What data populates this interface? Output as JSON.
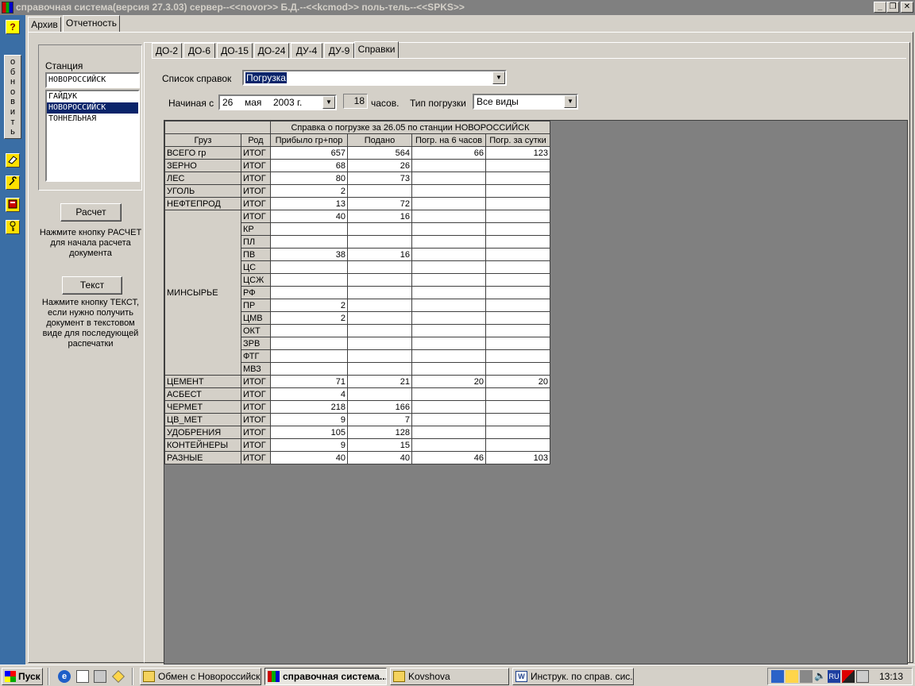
{
  "window": {
    "title": "справочная система(версия 27.3.03) сервер--<<novor>> Б.Д.--<<kcmod>> поль-тель--<<SPKS>>",
    "min_label": "_",
    "max_label": "❐",
    "close_label": "✕"
  },
  "left_toolbar": {
    "help_label": "?",
    "refresh_label": "обновить"
  },
  "top_tabs": [
    {
      "label": "Архив"
    },
    {
      "label": "Отчетность"
    }
  ],
  "station_panel": {
    "label": "Станция",
    "input_value": "НОВОРОССИЙСК",
    "list": [
      "ГАЙДУК",
      "НОВОРОССИЙСК",
      "ТОННЕЛЬНАЯ"
    ],
    "selected_index": 1
  },
  "calc": {
    "button": "Расчет",
    "hint": "Нажмите кнопку РАСЧЕТ для начала расчета документа"
  },
  "text": {
    "button": "Текст",
    "hint": "Нажмите кнопку ТЕКСТ, если нужно получить документ в текстовом виде для последующей распечатки"
  },
  "report_tabs": [
    {
      "label": "ДО-2"
    },
    {
      "label": "ДО-6"
    },
    {
      "label": "ДО-15"
    },
    {
      "label": "ДО-24"
    },
    {
      "label": "ДУ-4"
    },
    {
      "label": "ДУ-9"
    },
    {
      "label": "Справки"
    }
  ],
  "form": {
    "list_label": "Список справок",
    "list_value": "Погрузка",
    "start_label": "Начиная с",
    "day": "26",
    "month": "мая",
    "year": "2003 г.",
    "hours_value": "18",
    "hours_label": "часов.",
    "load_type_label": "Тип погрузки",
    "load_type_value": "Все виды"
  },
  "grid": {
    "caption": "Справка о погрузке за 26.05 по станции НОВОРОССИЙСК",
    "headers": [
      "Груз",
      "Род",
      "Прибыло гр+пор",
      "Подано",
      "Погр. на 6 часов",
      "Погр. за сутки"
    ],
    "rows": [
      {
        "cargo": "ВСЕГО   гр",
        "kind": "ИТОГ",
        "arrived": "657",
        "supplied": "564",
        "load6": "66",
        "load24": "123"
      },
      {
        "cargo": "ЗЕРНО",
        "kind": "ИТОГ",
        "arrived": "68",
        "supplied": "26",
        "load6": "",
        "load24": ""
      },
      {
        "cargo": "ЛЕС",
        "kind": "ИТОГ",
        "arrived": "80",
        "supplied": "73",
        "load6": "",
        "load24": ""
      },
      {
        "cargo": "УГОЛЬ",
        "kind": "ИТОГ",
        "arrived": "2",
        "supplied": "",
        "load6": "",
        "load24": ""
      },
      {
        "cargo": "НЕФТЕПРОД",
        "kind": "ИТОГ",
        "arrived": "13",
        "supplied": "72",
        "load6": "",
        "load24": ""
      }
    ],
    "minsyrye": {
      "cargo": "МИНСЫРЬЕ",
      "rows": [
        {
          "kind": "ИТОГ",
          "arrived": "40",
          "supplied": "16",
          "load6": "",
          "load24": ""
        },
        {
          "kind": "КР",
          "arrived": "",
          "supplied": "",
          "load6": "",
          "load24": ""
        },
        {
          "kind": "ПЛ",
          "arrived": "",
          "supplied": "",
          "load6": "",
          "load24": ""
        },
        {
          "kind": "ПВ",
          "arrived": "38",
          "supplied": "16",
          "load6": "",
          "load24": ""
        },
        {
          "kind": "ЦС",
          "arrived": "",
          "supplied": "",
          "load6": "",
          "load24": ""
        },
        {
          "kind": "ЦСЖ",
          "arrived": "",
          "supplied": "",
          "load6": "",
          "load24": ""
        },
        {
          "kind": "РФ",
          "arrived": "",
          "supplied": "",
          "load6": "",
          "load24": ""
        },
        {
          "kind": "ПР",
          "arrived": "2",
          "supplied": "",
          "load6": "",
          "load24": ""
        },
        {
          "kind": "ЦМВ",
          "arrived": "2",
          "supplied": "",
          "load6": "",
          "load24": ""
        },
        {
          "kind": "ОКТ",
          "arrived": "",
          "supplied": "",
          "load6": "",
          "load24": ""
        },
        {
          "kind": "ЗРВ",
          "arrived": "",
          "supplied": "",
          "load6": "",
          "load24": ""
        },
        {
          "kind": "ФТГ",
          "arrived": "",
          "supplied": "",
          "load6": "",
          "load24": ""
        },
        {
          "kind": "МВЗ",
          "arrived": "",
          "supplied": "",
          "load6": "",
          "load24": ""
        }
      ]
    },
    "rows_after": [
      {
        "cargo": "ЦЕМЕНТ",
        "kind": "ИТОГ",
        "arrived": "71",
        "supplied": "21",
        "load6": "20",
        "load24": "20"
      },
      {
        "cargo": "АСБЕСТ",
        "kind": "ИТОГ",
        "arrived": "4",
        "supplied": "",
        "load6": "",
        "load24": ""
      },
      {
        "cargo": "ЧЕРМЕТ",
        "kind": "ИТОГ",
        "arrived": "218",
        "supplied": "166",
        "load6": "",
        "load24": ""
      },
      {
        "cargo": "ЦВ_МЕТ",
        "kind": "ИТОГ",
        "arrived": "9",
        "supplied": "7",
        "load6": "",
        "load24": ""
      },
      {
        "cargo": "УДОБРЕНИЯ",
        "kind": "ИТОГ",
        "arrived": "105",
        "supplied": "128",
        "load6": "",
        "load24": ""
      },
      {
        "cargo": "КОНТЕЙНЕРЫ",
        "kind": "ИТОГ",
        "arrived": "9",
        "supplied": "15",
        "load6": "",
        "load24": ""
      },
      {
        "cargo": "РАЗНЫЕ",
        "kind": "ИТОГ",
        "arrived": "40",
        "supplied": "40",
        "load6": "46",
        "load24": "103"
      }
    ]
  },
  "taskbar": {
    "start": "Пуск",
    "items": [
      {
        "label": "Обмен с Новороссийск...",
        "icon": "folder-icon"
      },
      {
        "label": "справочная система...",
        "icon": "app-icon"
      },
      {
        "label": "Kovshova",
        "icon": "folder-icon"
      },
      {
        "label": "Инструк. по справ. сис...",
        "icon": "word-icon"
      }
    ],
    "lang": "RU",
    "clock": "13:13"
  }
}
